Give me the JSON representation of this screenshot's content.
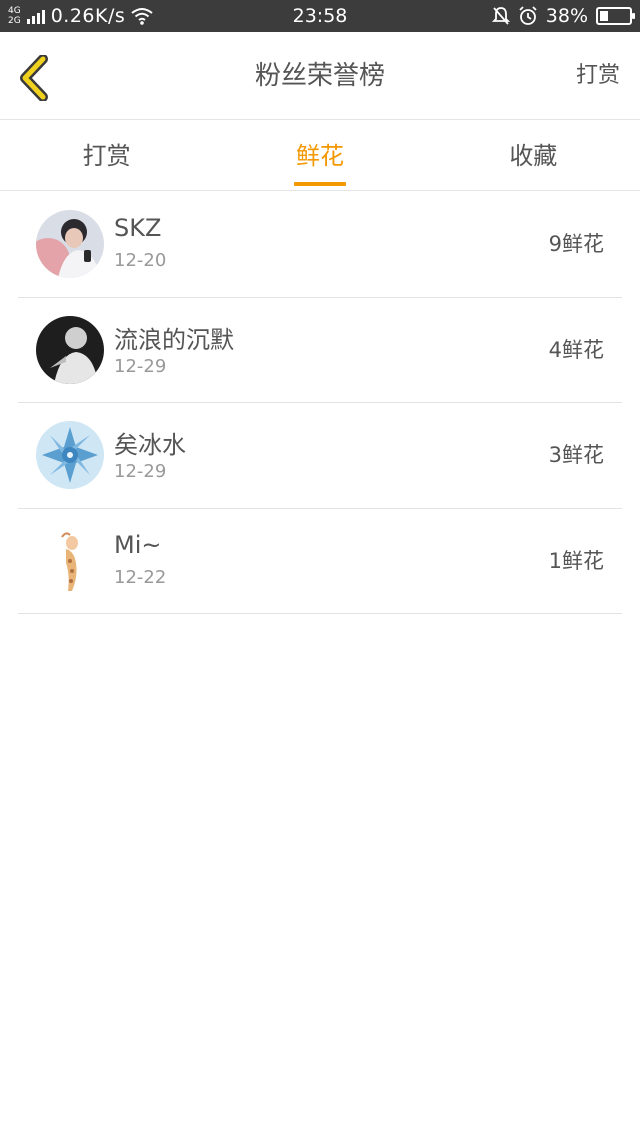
{
  "status_bar": {
    "net_type_top": "4G",
    "net_type_bottom": "2G",
    "speed": "0.26K/s",
    "time": "23:58",
    "battery": "38%",
    "battery_level": 0.38
  },
  "header": {
    "title": "粉丝荣誉榜",
    "action_label": "打赏"
  },
  "tabs": [
    {
      "label": "打赏",
      "active": false
    },
    {
      "label": "鲜花",
      "active": true
    },
    {
      "label": "收藏",
      "active": false
    }
  ],
  "list": [
    {
      "name": "SKZ",
      "date": "12-20",
      "count": "9鲜花"
    },
    {
      "name": "流浪的沉默",
      "date": "12-29",
      "count": "4鲜花"
    },
    {
      "name": "矣冰水",
      "date": "12-29",
      "count": "3鲜花"
    },
    {
      "name": "Mi~",
      "date": "12-22",
      "count": "1鲜花"
    }
  ],
  "colors": {
    "accent": "#f39800",
    "status_bar_bg": "#3c3c3c",
    "back_arrow": "#f0d21e"
  }
}
